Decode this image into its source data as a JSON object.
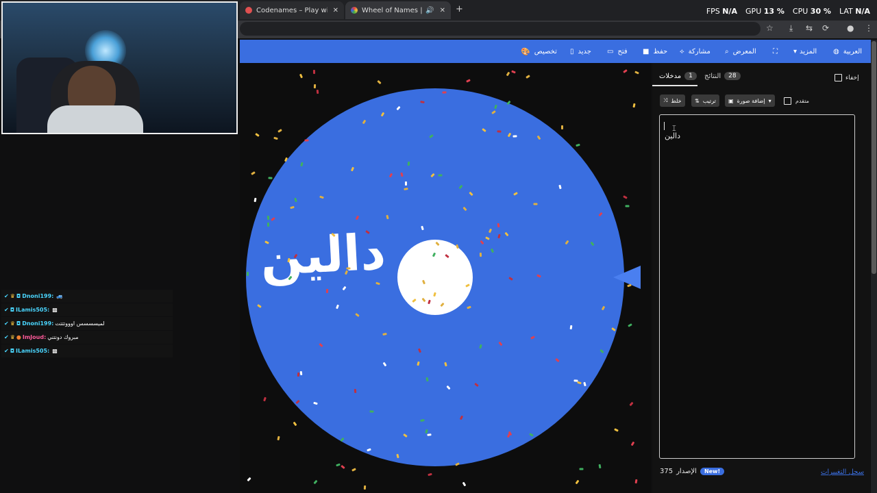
{
  "browser": {
    "tabs": [
      {
        "title": "Codenames – Play with your Fr",
        "active": false
      },
      {
        "title": "Wheel of Names | العشوائي",
        "active": true
      }
    ],
    "stats": {
      "fps_label": "FPS",
      "fps": "N/A",
      "gpu_label": "GPU",
      "gpu": "13 %",
      "cpu_label": "CPU",
      "cpu": "30 %",
      "lat_label": "LAT",
      "lat": "N/A"
    }
  },
  "toolbar": {
    "customize": "تخصيص",
    "new": "جديد",
    "open": "فتح",
    "save": "حفظ",
    "share": "مشاركة",
    "gallery": "المعرض",
    "more": "المزيد",
    "language": "العربية"
  },
  "wheel": {
    "label": "دالين",
    "colors": {
      "wheel": "#3a6ee0",
      "hub": "#ffffff"
    }
  },
  "panel": {
    "hide_label": "إخفاء",
    "results_label": "النتائج",
    "results_count": "28",
    "entries_label": "مدخلات",
    "entries_count": "1",
    "shuffle_label": "خلط",
    "sort_label": "ترتيب",
    "add_image_label": "إضافة صورة",
    "advanced_label": "متقدم",
    "entries": [
      "دالين"
    ],
    "version_label": "الإصدار",
    "version": "375",
    "new_badge": "New!",
    "changelog": "سجل التغييرات"
  },
  "chat": [
    {
      "user": "Dnoni199:",
      "msg": "",
      "style": "u1"
    },
    {
      "user": "ILamis505:",
      "msg": "",
      "style": "u1"
    },
    {
      "user": "Dnoni199:",
      "msg": "لميسسسس اوووتتتت",
      "style": "u1"
    },
    {
      "user": "ImJoud:",
      "msg": "مبروك دونتني",
      "style": "u2"
    },
    {
      "user": "ILamis505:",
      "msg": "",
      "style": "u1"
    }
  ]
}
